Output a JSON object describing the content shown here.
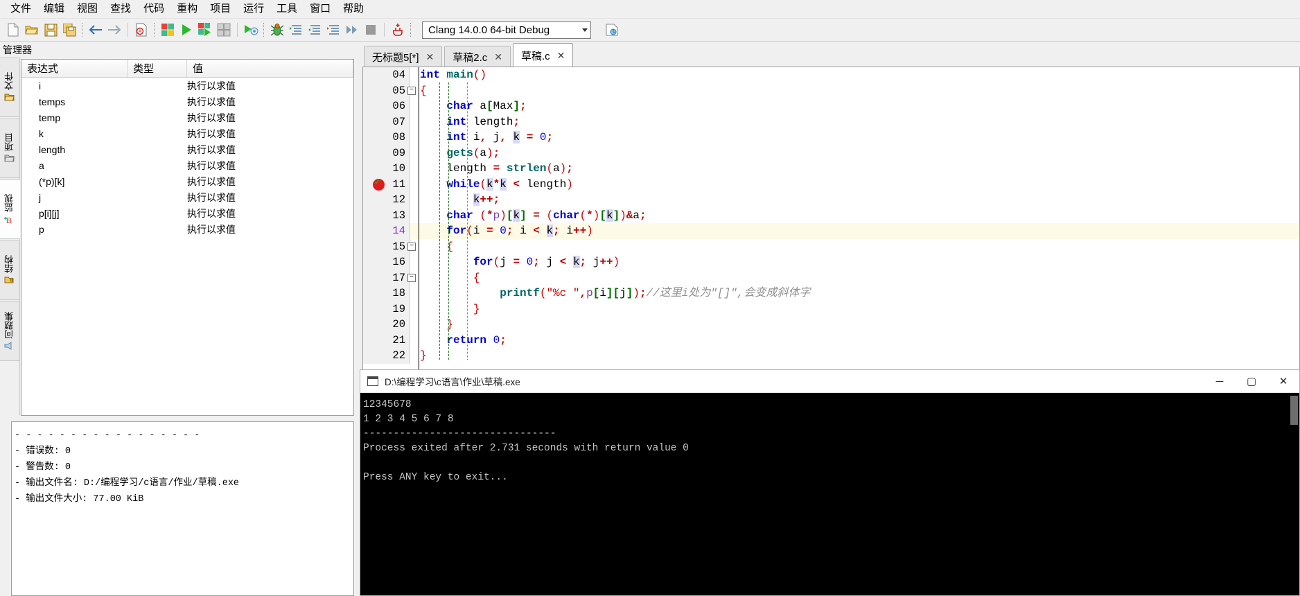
{
  "menubar": {
    "items": [
      {
        "label": "文件",
        "name": "menu-file"
      },
      {
        "label": "编辑",
        "name": "menu-edit"
      },
      {
        "label": "视图",
        "name": "menu-view"
      },
      {
        "label": "查找",
        "name": "menu-search"
      },
      {
        "label": "代码",
        "name": "menu-code"
      },
      {
        "label": "重构",
        "name": "menu-refactor"
      },
      {
        "label": "项目",
        "name": "menu-project"
      },
      {
        "label": "运行",
        "name": "menu-run"
      },
      {
        "label": "工具",
        "name": "menu-tools"
      },
      {
        "label": "窗口",
        "name": "menu-window"
      },
      {
        "label": "帮助",
        "name": "menu-help"
      }
    ]
  },
  "toolbar": {
    "compiler_value": "Clang 14.0.0 64-bit Debug",
    "icons": [
      "new-file-icon",
      "open-folder-icon",
      "save-icon",
      "save-all-icon",
      "back-arrow-icon",
      "forward-arrow-icon",
      "find-icon",
      "compile-icon",
      "run-icon",
      "compile-run-icon",
      "rebuild-icon",
      "run-options-icon",
      "debug-bug-icon",
      "step-over-icon",
      "step-into-icon",
      "step-out-icon",
      "continue-icon",
      "stop-icon",
      "breakpoint-add-icon",
      "profile-icon"
    ]
  },
  "manager": {
    "title": "管理器",
    "vtabs": [
      {
        "label": "文件",
        "icon": "folder-icon",
        "selected": false,
        "name": "vtab-files"
      },
      {
        "label": "项目",
        "icon": "project-icon",
        "selected": false,
        "name": "vtab-project"
      },
      {
        "label": "监视",
        "icon": "watch-icon",
        "selected": true,
        "name": "vtab-watch"
      },
      {
        "label": "结构",
        "icon": "structure-icon",
        "selected": false,
        "name": "vtab-structure"
      },
      {
        "label": "问题集",
        "icon": "problems-icon",
        "selected": false,
        "name": "vtab-problems"
      }
    ]
  },
  "watch": {
    "columns": [
      "表达式",
      "类型",
      "值"
    ],
    "rows": [
      {
        "expr": "i",
        "type": "",
        "value": "执行以求值"
      },
      {
        "expr": "temps",
        "type": "",
        "value": "执行以求值"
      },
      {
        "expr": "temp",
        "type": "",
        "value": "执行以求值"
      },
      {
        "expr": "k",
        "type": "",
        "value": "执行以求值"
      },
      {
        "expr": "length",
        "type": "",
        "value": "执行以求值"
      },
      {
        "expr": "a",
        "type": "",
        "value": "执行以求值"
      },
      {
        "expr": "(*p)[k]",
        "type": "",
        "value": "执行以求值"
      },
      {
        "expr": "j",
        "type": "",
        "value": "执行以求值"
      },
      {
        "expr": "p[i][j]",
        "type": "",
        "value": "执行以求值"
      },
      {
        "expr": "p",
        "type": "",
        "value": "执行以求值"
      }
    ]
  },
  "log": {
    "lines": [
      "- - - - - - - - - - - - - - - - -",
      "- 错误数: 0",
      "- 警告数: 0",
      "- 输出文件名: D:/编程学习/c语言/作业/草稿.exe",
      "- 输出文件大小: 77.00 KiB"
    ]
  },
  "editor": {
    "tabs": [
      {
        "label": "无标题5[*]",
        "close": "✕",
        "active": false,
        "name": "editor-tab-untitled5"
      },
      {
        "label": "草稿2.c",
        "close": "✕",
        "active": false,
        "name": "editor-tab-caogao2"
      },
      {
        "label": "草稿.c",
        "close": "✕",
        "active": true,
        "name": "editor-tab-caogao"
      }
    ],
    "code_lines": [
      {
        "num": "04",
        "fold": "",
        "bp": false,
        "current": false
      },
      {
        "num": "05",
        "fold": "−",
        "bp": false,
        "current": false
      },
      {
        "num": "06",
        "fold": "",
        "bp": false,
        "current": false
      },
      {
        "num": "07",
        "fold": "",
        "bp": false,
        "current": false
      },
      {
        "num": "08",
        "fold": "",
        "bp": false,
        "current": false
      },
      {
        "num": "09",
        "fold": "",
        "bp": false,
        "current": false
      },
      {
        "num": "10",
        "fold": "",
        "bp": false,
        "current": false
      },
      {
        "num": "11",
        "fold": "",
        "bp": true,
        "current": false
      },
      {
        "num": "12",
        "fold": "",
        "bp": false,
        "current": false
      },
      {
        "num": "13",
        "fold": "",
        "bp": false,
        "current": false
      },
      {
        "num": "14",
        "fold": "",
        "bp": false,
        "current": true
      },
      {
        "num": "15",
        "fold": "−",
        "bp": false,
        "current": false
      },
      {
        "num": "16",
        "fold": "",
        "bp": false,
        "current": false
      },
      {
        "num": "17",
        "fold": "−",
        "bp": false,
        "current": false
      },
      {
        "num": "18",
        "fold": "",
        "bp": false,
        "current": false
      },
      {
        "num": "19",
        "fold": "",
        "bp": false,
        "current": false
      },
      {
        "num": "20",
        "fold": "",
        "bp": false,
        "current": false
      },
      {
        "num": "21",
        "fold": "",
        "bp": false,
        "current": false
      },
      {
        "num": "22",
        "fold": "",
        "bp": false,
        "current": false
      }
    ],
    "code_text": [
      "int main()",
      "{",
      "    char a[Max];",
      "    int length;",
      "    int i, j, k = 0;",
      "    gets(a);",
      "    length = strlen(a);",
      "    while(k*k < length)",
      "        k++;",
      "    char (*p)[k] = (char(*)[k])&a;",
      "    for(i = 0; i < k; i++)",
      "    {",
      "        for(j = 0; j < k; j++)",
      "        {",
      "            printf(\"%c \",p[i][j]);//这里i处为\"[]\",会变成斜体字",
      "        }",
      "    }",
      "    return 0;",
      "}"
    ],
    "comment_text": "//这里i处为\"[]\",会变成斜体字"
  },
  "console": {
    "title": "D:\\编程学习\\c语言\\作业\\草稿.exe",
    "minimize": "─",
    "maximize": "▢",
    "close": "✕",
    "output": [
      "12345678",
      "1 2 3 4 5 6 7 8",
      "--------------------------------",
      "Process exited after 2.731 seconds with return value 0",
      "",
      "Press ANY key to exit..."
    ]
  },
  "colors": {
    "keyword": "#0000d0",
    "string": "#cc0000",
    "comment": "#909090",
    "breakpoint": "#e01b1b",
    "current_line": "#fdfbe8",
    "accent": "#d6e8f7"
  }
}
